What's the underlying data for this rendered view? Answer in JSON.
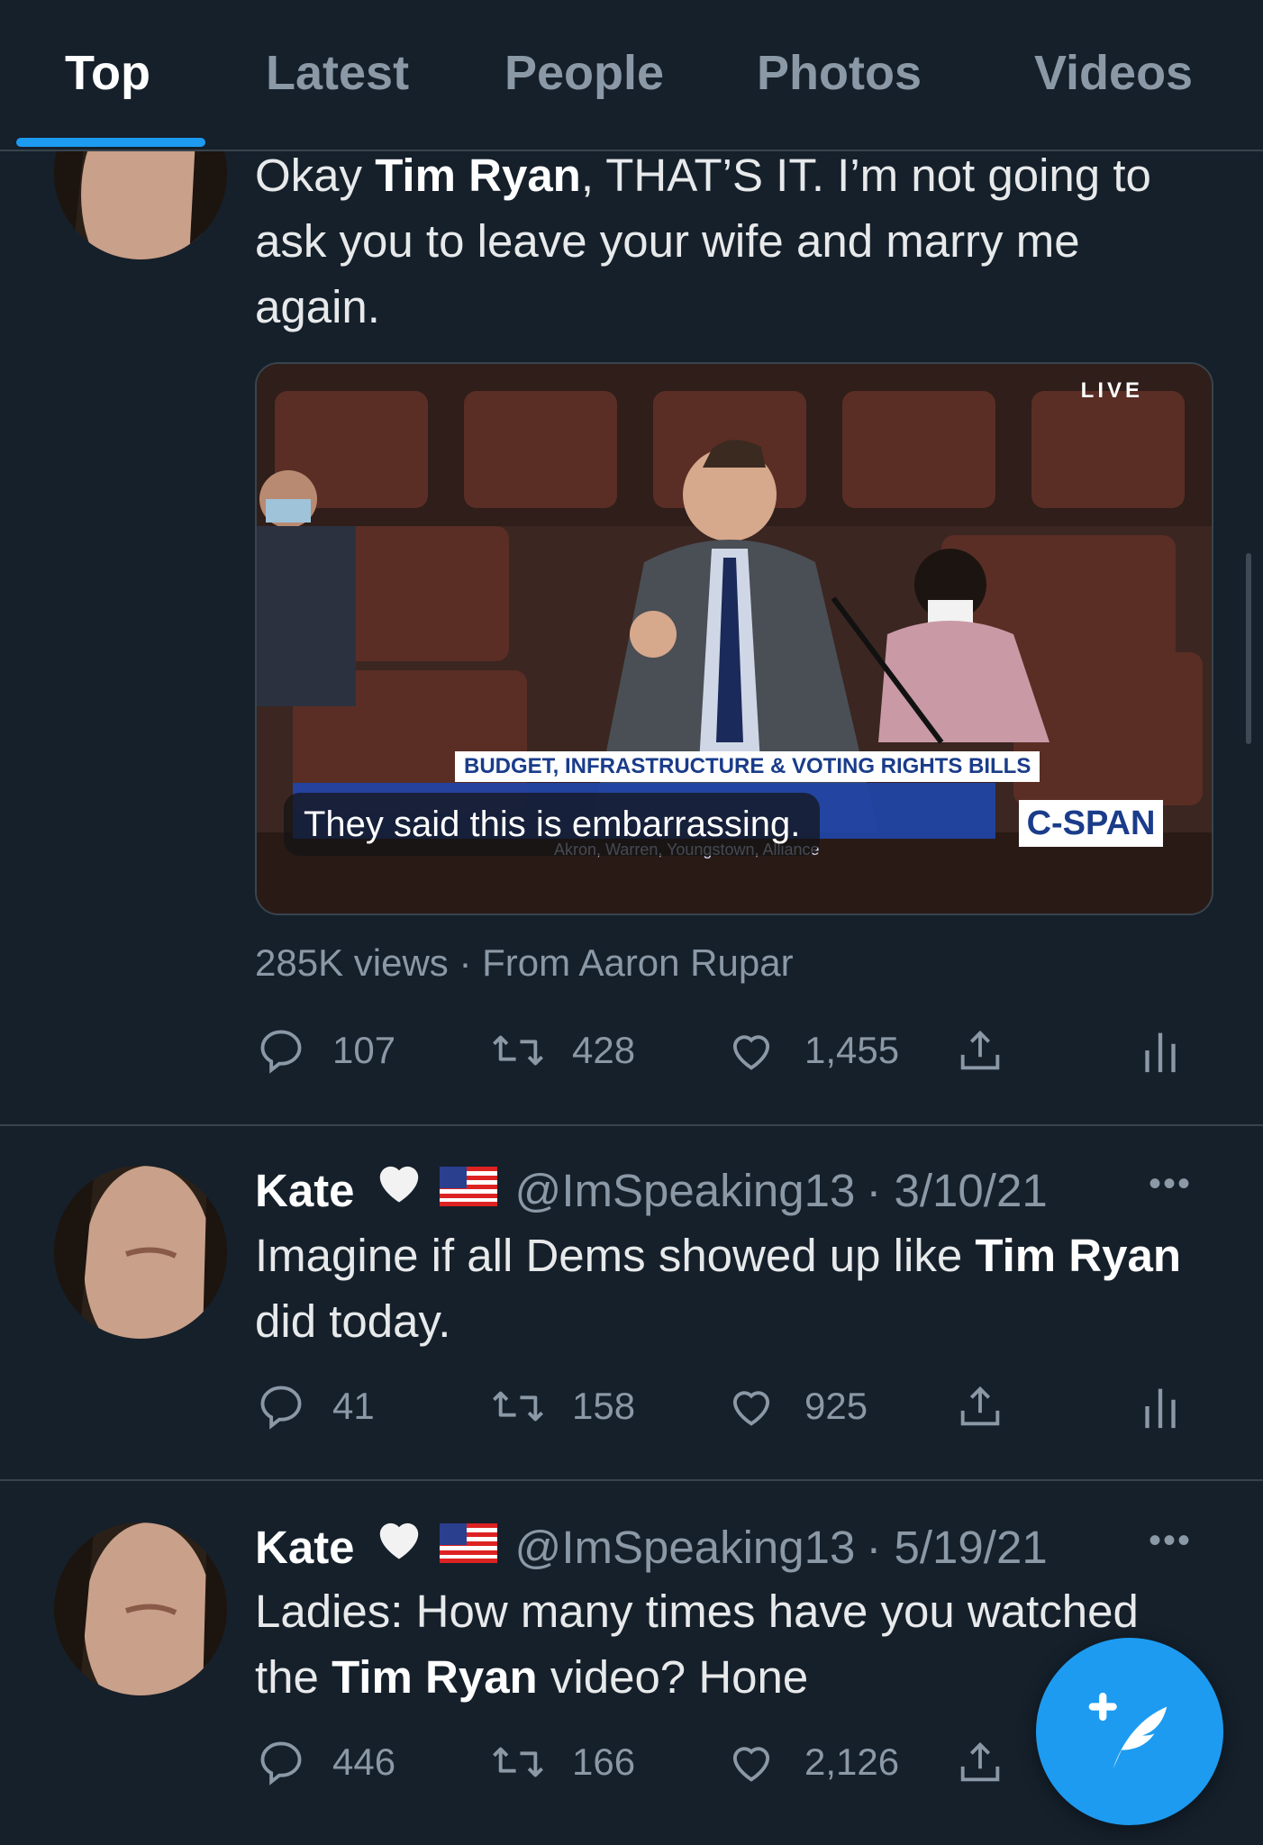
{
  "tabs": [
    {
      "label": "Top",
      "active": true
    },
    {
      "label": "Latest"
    },
    {
      "label": "People"
    },
    {
      "label": "Photos"
    },
    {
      "label": "Videos"
    }
  ],
  "tweet1": {
    "text_parts": [
      "Okay ",
      "Tim Ryan",
      ", THAT’S IT. I’m not going to ask you to leave your wife and marry me again."
    ],
    "media": {
      "live_label": "LIVE",
      "chyron": "BUDGET, INFRASTRUCTURE & VOTING RIGHTS BILLS",
      "caption": "They said this is embarrassing.",
      "network": "C-SPAN"
    },
    "meta": "285K views · From Aaron Rupar",
    "replies": "107",
    "retweets": "428",
    "likes": "1,455"
  },
  "tweet2": {
    "name": "Kate",
    "handle": "@ImSpeaking13",
    "date": "· 3/10/21",
    "text_parts": [
      "Imagine if all Dems showed up like ",
      "Tim Ryan",
      " did today."
    ],
    "replies": "41",
    "retweets": "158",
    "likes": "925"
  },
  "tweet3": {
    "name": "Kate",
    "handle": "@ImSpeaking13",
    "date": "· 5/19/21",
    "text_parts": [
      "Ladies: How many times have you watched the ",
      "Tim Ryan",
      " video? Hone"
    ],
    "replies": "446",
    "retweets": "166",
    "likes": "2,126"
  },
  "more_label": "•••",
  "colors": {
    "background": "#15202b",
    "accent": "#1d9bf0",
    "muted": "#8b98a5",
    "divider": "#38444d"
  },
  "icons": [
    "reply-icon",
    "retweet-icon",
    "like-icon",
    "share-icon",
    "analytics-icon",
    "compose-tweet-icon",
    "white-heart-emoji",
    "us-flag-emoji"
  ]
}
